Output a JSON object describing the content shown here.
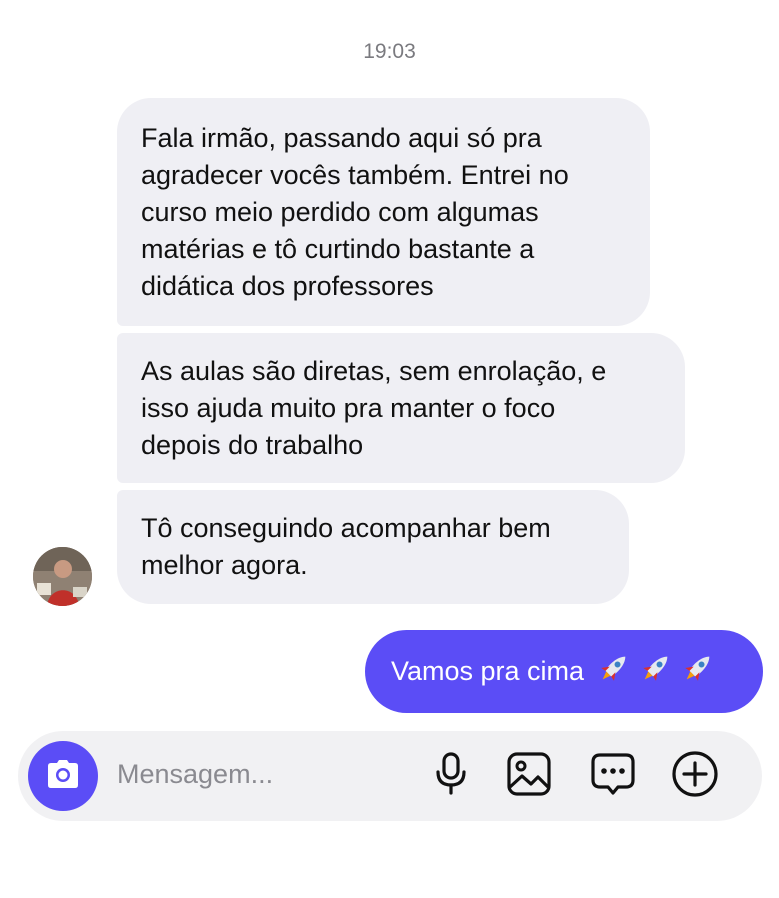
{
  "chat": {
    "timestamp": "19:03",
    "incoming": [
      "Fala irmão, passando aqui só pra\nagradecer vocês também. Entrei no\ncurso meio perdido com algumas\nmatérias e tô curtindo bastante a\ndidática dos professores",
      "As aulas são diretas, sem enrolação, e\nisso ajuda muito pra manter o foco\ndepois do trabalho",
      "Tô conseguindo acompanhar bem\nmelhor agora."
    ],
    "outgoing": {
      "text": "Vamos pra cima",
      "emoji_icons": [
        "rocket-icon",
        "rocket-icon",
        "rocket-icon"
      ]
    }
  },
  "composer": {
    "placeholder": "Mensagem...",
    "icons": {
      "camera": "camera-icon",
      "microphone": "microphone-icon",
      "gallery": "image-icon",
      "sticker": "chat-bubble-icon",
      "more": "plus-circle-icon"
    }
  },
  "colors": {
    "accent": "#5b4df6",
    "incoming_bubble": "#efeff4",
    "composer_bg": "#f1f1f3",
    "timestamp": "#7a7a7f"
  }
}
